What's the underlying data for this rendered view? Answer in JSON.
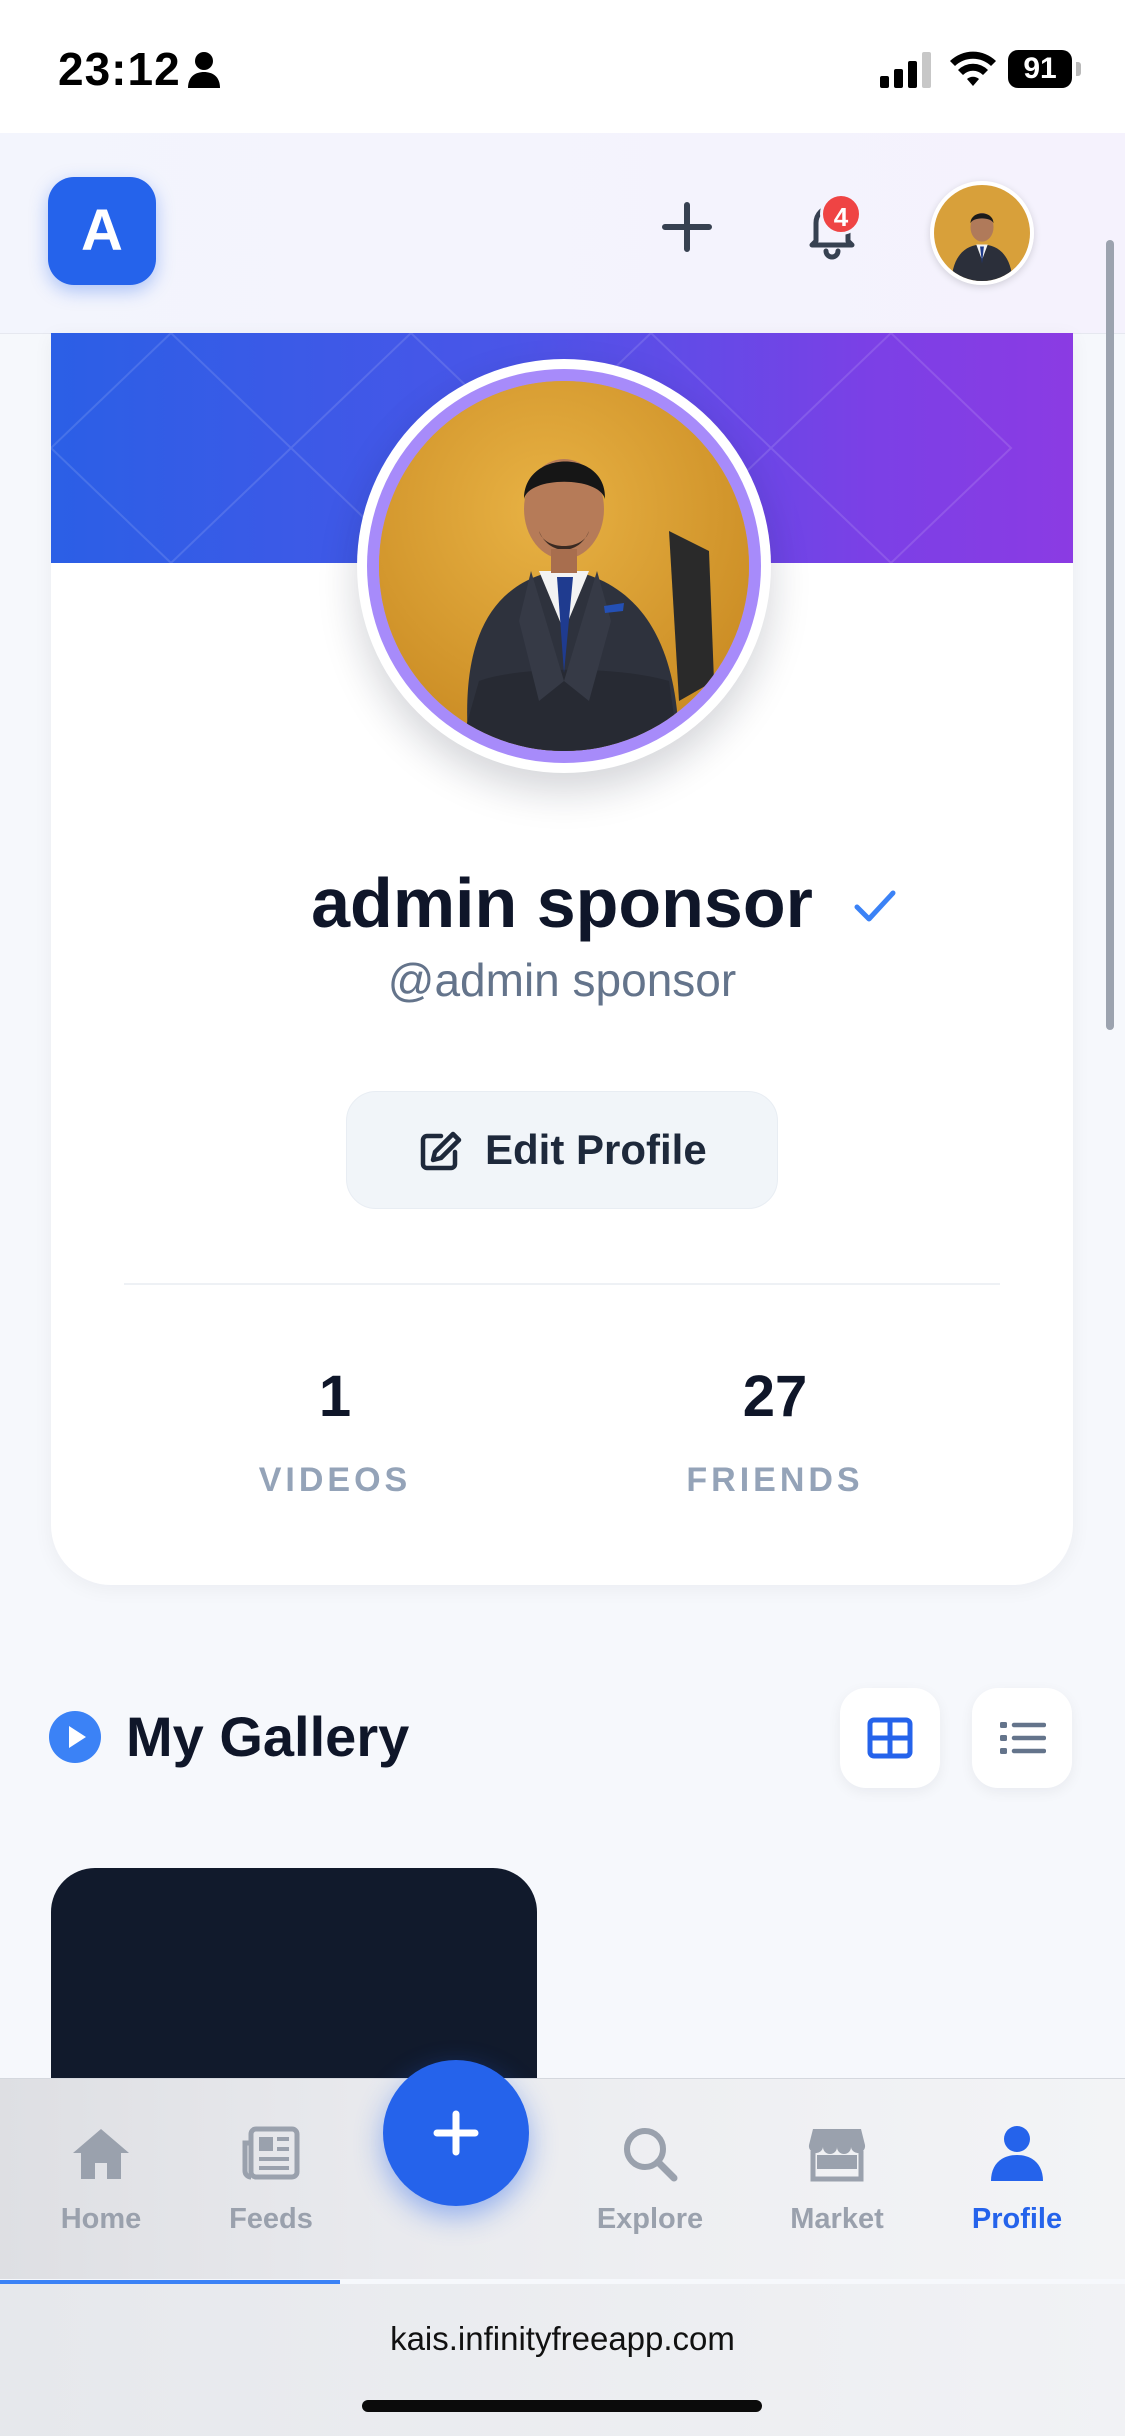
{
  "status_bar": {
    "time": "23:12",
    "battery": "91"
  },
  "header": {
    "logo_letter": "A",
    "notification_count": "4"
  },
  "profile": {
    "name": "admin sponsor",
    "handle": "@admin sponsor",
    "edit_button": "Edit Profile",
    "stats": [
      {
        "value": "1",
        "label": "VIDEOS"
      },
      {
        "value": "27",
        "label": "FRIENDS"
      }
    ]
  },
  "gallery": {
    "title": "My Gallery"
  },
  "bottom_nav": {
    "items": [
      {
        "label": "Home",
        "icon": "home-icon"
      },
      {
        "label": "Feeds",
        "icon": "newspaper-icon"
      },
      {
        "label": "Explore",
        "icon": "search-icon"
      },
      {
        "label": "Market",
        "icon": "store-icon"
      },
      {
        "label": "Profile",
        "icon": "user-icon"
      }
    ],
    "active": "Profile"
  },
  "browser": {
    "url": "kais.infinityfreeapp.com"
  },
  "colors": {
    "accent": "#2563eb",
    "badge": "#ef4444",
    "banner_start": "#2b5fe6",
    "banner_end": "#8b3be3"
  }
}
